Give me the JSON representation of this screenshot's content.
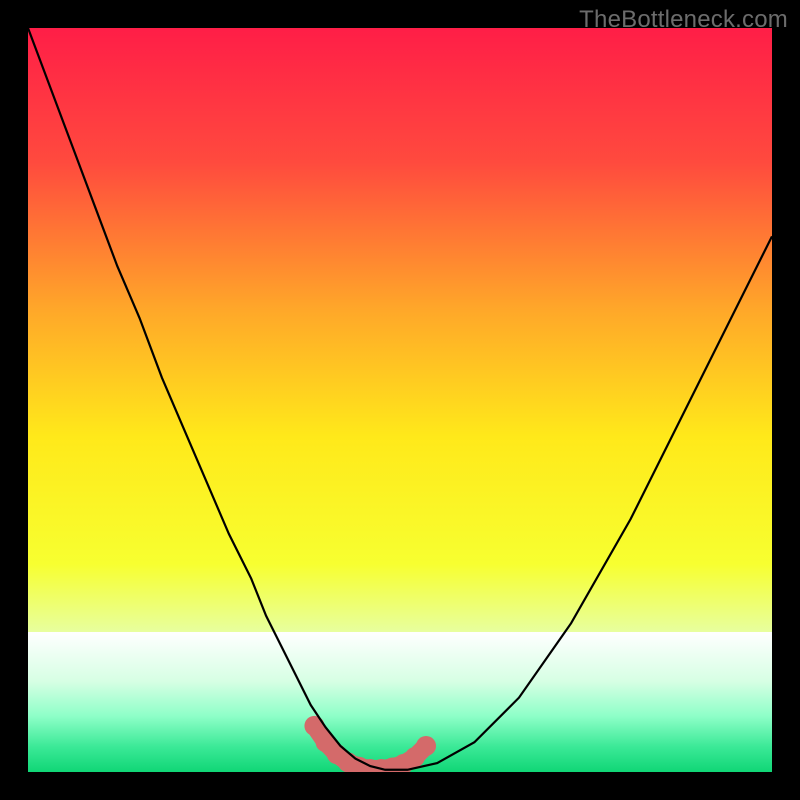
{
  "watermark": "TheBottleneck.com",
  "colors": {
    "frame": "#000000",
    "gradient_stops": [
      {
        "offset": 0.0,
        "color": "#ff1e47"
      },
      {
        "offset": 0.18,
        "color": "#ff4a3e"
      },
      {
        "offset": 0.38,
        "color": "#ffa829"
      },
      {
        "offset": 0.55,
        "color": "#ffe91a"
      },
      {
        "offset": 0.72,
        "color": "#f7ff30"
      },
      {
        "offset": 0.82,
        "color": "#e6ffa8"
      },
      {
        "offset": 0.885,
        "color": "#cbffd5"
      },
      {
        "offset": 0.925,
        "color": "#7dffc3"
      },
      {
        "offset": 0.965,
        "color": "#23e98d"
      },
      {
        "offset": 1.0,
        "color": "#0fd977"
      }
    ],
    "bottom_fade": [
      {
        "offset": 0.0,
        "color": "#ffffff"
      },
      {
        "offset": 0.35,
        "color": "#d7ffe4"
      },
      {
        "offset": 0.6,
        "color": "#8effc8"
      },
      {
        "offset": 0.82,
        "color": "#3be997"
      },
      {
        "offset": 1.0,
        "color": "#10d676"
      }
    ],
    "curve": "#000000",
    "marker": "#d46a6a"
  },
  "chart_data": {
    "type": "line",
    "title": "",
    "xlabel": "",
    "ylabel": "",
    "xlim": [
      0,
      100
    ],
    "ylim": [
      0,
      100
    ],
    "series": [
      {
        "name": "bottleneck-curve",
        "x": [
          0,
          3,
          6,
          9,
          12,
          15,
          18,
          21,
          24,
          27,
          30,
          32,
          34,
          36,
          38,
          40,
          42,
          44,
          46,
          48,
          51,
          55,
          60,
          66,
          73,
          81,
          90,
          100
        ],
        "y": [
          100,
          92,
          84,
          76,
          68,
          61,
          53,
          46,
          39,
          32,
          26,
          21,
          17,
          13,
          9,
          6,
          3.5,
          1.8,
          0.8,
          0.3,
          0.3,
          1.2,
          4,
          10,
          20,
          34,
          52,
          72
        ]
      }
    ],
    "markers": {
      "name": "highlight-valley",
      "x": [
        38.5,
        40.0,
        41.5,
        43.0,
        44.5,
        46.0,
        47.5,
        49.0,
        50.5,
        52.0,
        53.5
      ],
      "y": [
        6.2,
        4.0,
        2.4,
        1.3,
        0.7,
        0.4,
        0.4,
        0.6,
        1.1,
        2.0,
        3.5
      ]
    }
  }
}
